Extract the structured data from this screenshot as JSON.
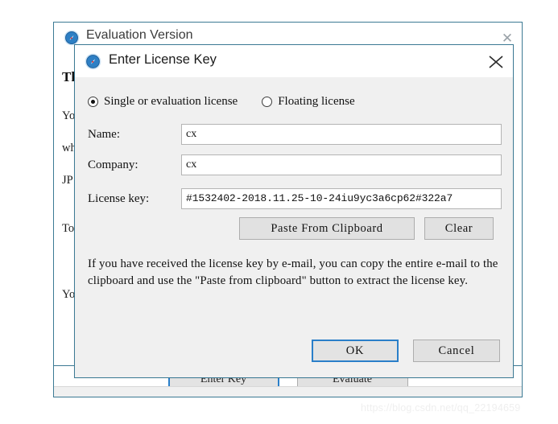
{
  "background_window": {
    "title": "Evaluation Version",
    "icon": "compass-icon",
    "close_label": "✕",
    "heading": "Th",
    "paragraphs": {
      "p1": "Yo",
      "p2": "wh",
      "p3": "JP",
      "p4": "To",
      "p5": "Yo"
    },
    "buttons": {
      "enter_key": "Enter Key",
      "evaluate": "Evaluate"
    }
  },
  "dialog": {
    "title": "Enter License Key",
    "icon": "compass-icon",
    "close_label": "close-icon",
    "license_type": {
      "single": {
        "label": "Single or evaluation license",
        "selected": true
      },
      "floating": {
        "label": "Floating license",
        "selected": false
      }
    },
    "fields": {
      "name": {
        "label": "Name:",
        "value": "cx",
        "placeholder": ""
      },
      "company": {
        "label": "Company:",
        "value": "cx",
        "placeholder": ""
      },
      "license_key": {
        "label": "License key:",
        "value": "#1532402-2018.11.25-10-24iu9yc3a6cp62#322a7",
        "placeholder": ""
      }
    },
    "buttons": {
      "paste_from_clipboard": "Paste From Clipboard",
      "clear": "Clear",
      "ok": "OK",
      "cancel": "Cancel"
    },
    "info_text": "If you have received the license key by e-mail, you can copy the entire e-mail to the clipboard and use the \"Paste from clipboard\" button to extract the license key.",
    "colors": {
      "focus_border": "#2a7fc9",
      "window_border": "#3c7a94",
      "dialog_background": "#f0f0f0",
      "titlebar_background": "#ffffff"
    }
  },
  "watermark": {
    "text": "https://blog.csdn.net/qq_22194659"
  }
}
